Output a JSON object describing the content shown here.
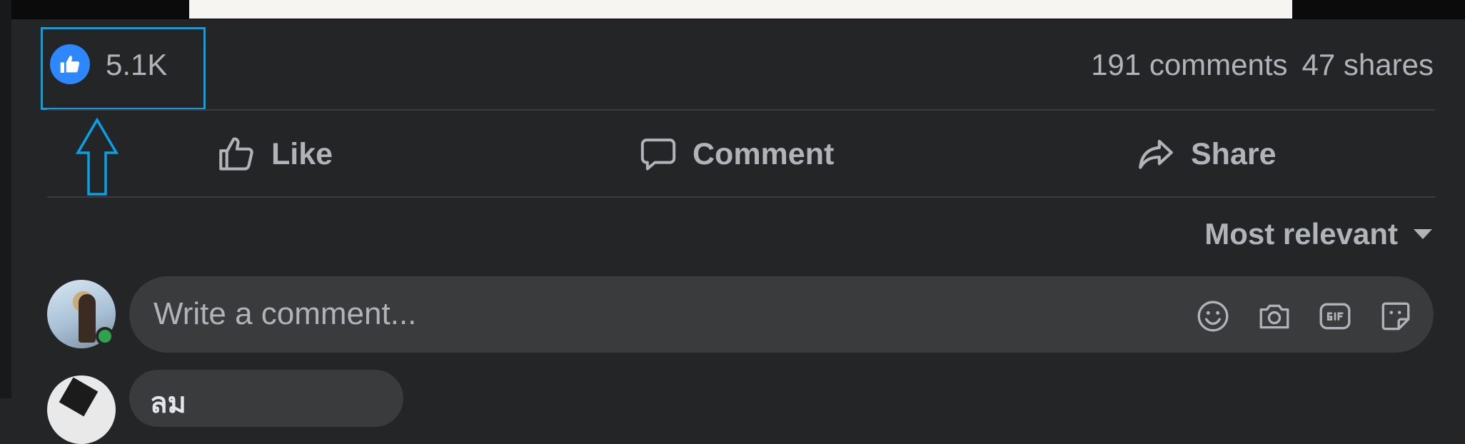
{
  "post": {
    "reactions": {
      "count": "5.1K",
      "icon": "like-reaction-icon"
    },
    "comments_count": "191 comments",
    "shares_count": "47 shares"
  },
  "actions": {
    "like_label": "Like",
    "comment_label": "Comment",
    "share_label": "Share"
  },
  "comments": {
    "sort_label": "Most relevant",
    "input_placeholder": "Write a comment...",
    "input_icons": [
      "emoji-icon",
      "camera-icon",
      "gif-icon",
      "sticker-icon"
    ],
    "next_author": "ลม"
  },
  "colors": {
    "background": "#242526",
    "like_blue": "#2d88ff",
    "highlight": "#0aa0e6",
    "online": "#31a24c"
  }
}
